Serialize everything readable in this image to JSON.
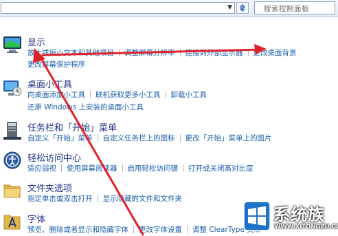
{
  "toolbar": {
    "address_value": "",
    "search_placeholder": "搜索控制面板"
  },
  "categories": [
    {
      "title": "显示",
      "icon": "monitor-icon",
      "links": [
        [
          "放大或缩小文本和其他项目",
          "调整屏幕分辨率",
          "连接到外部显示器",
          "更改桌面背景"
        ],
        [
          "更改屏幕保护程序"
        ]
      ]
    },
    {
      "title": "桌面小工具",
      "icon": "gadgets-icon",
      "links": [
        [
          "向桌面添加小工具",
          "联机获取更多小工具",
          "卸载小工具"
        ],
        [
          "还原 Windows 上安装的桌面小工具"
        ]
      ]
    },
    {
      "title": "任务栏和「开始」菜单",
      "icon": "taskbar-icon",
      "links": [
        [
          "自定义「开始」菜单",
          "自定义任务栏上的图标",
          "更改「开始」菜单上的图片"
        ]
      ]
    },
    {
      "title": "轻松访问中心",
      "icon": "ease-of-access-icon",
      "links": [
        [
          "适应弱视",
          "使用屏幕阅读器",
          "启用轻松访问键",
          "打开或关闭高对比度"
        ]
      ]
    },
    {
      "title": "文件夹选项",
      "icon": "folder-icon",
      "links": [
        [
          "指定单击或双击打开",
          "显示隐藏的文件和文件夹"
        ]
      ]
    },
    {
      "title": "字体",
      "icon": "fonts-icon",
      "links": [
        [
          "预览、删除或者显示和隐藏字体",
          "更改字体设置",
          "调整 ClearType 文本"
        ]
      ]
    }
  ],
  "watermark": {
    "brand": "系统族",
    "url": "WWW.XITONGZU.COM"
  },
  "colors": {
    "link": "#1a5fab",
    "title": "#1e3287",
    "arrow": "#e0202a"
  }
}
